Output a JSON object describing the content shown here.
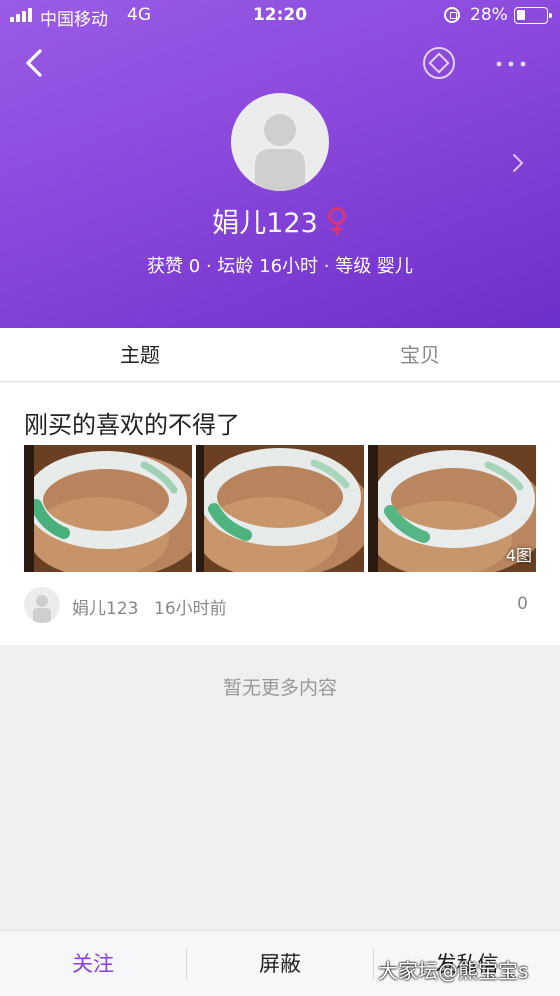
{
  "status_bar": {
    "carrier": "中国移动",
    "network": "4G",
    "time": "12:20",
    "battery": "28%"
  },
  "profile": {
    "username": "娟儿123",
    "gender_symbol": "♀",
    "stats": "获赞 0 · 坛龄 16小时 · 等级 婴儿"
  },
  "tabs": [
    {
      "label": "主题",
      "active": true
    },
    {
      "label": "宝贝",
      "active": false
    }
  ],
  "post": {
    "title": "刚买的喜欢的不得了",
    "image_count_label": "4图",
    "author": "娟儿123",
    "time": "16小时前",
    "count": "0"
  },
  "empty_text": "暂无更多内容",
  "bottom_bar": {
    "follow": "关注",
    "block": "屏蔽",
    "message": "发私信"
  },
  "watermark": "大家坛@熊宝宝s",
  "colors": {
    "header_gradient": [
      "#9a5ce6",
      "#6d2fc9"
    ],
    "accent": "#8a3fe0",
    "female_symbol": "#e0356a"
  }
}
